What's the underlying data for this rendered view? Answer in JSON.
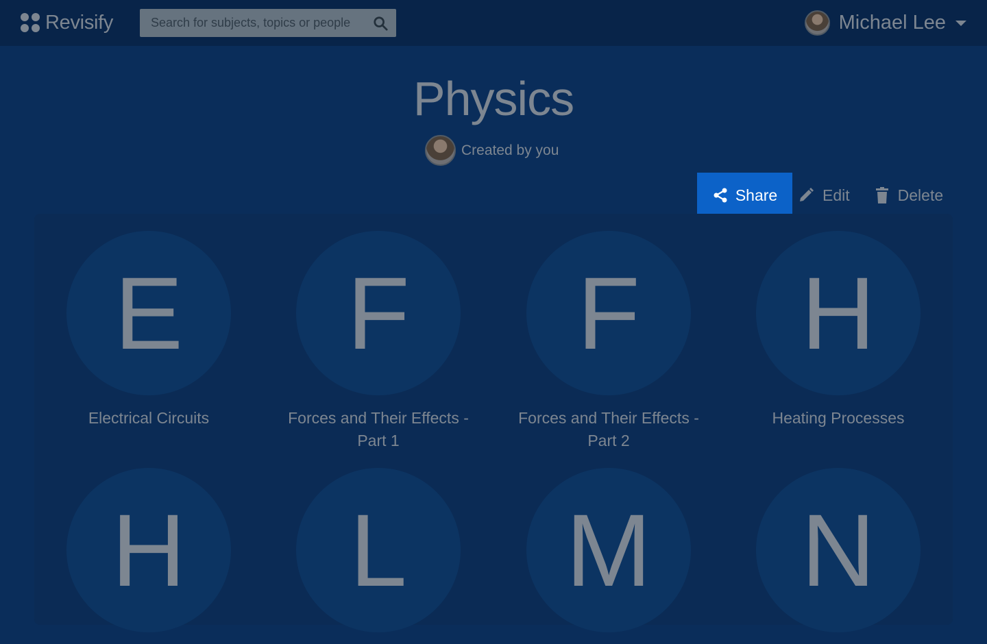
{
  "app": {
    "name": "Revisify"
  },
  "search": {
    "placeholder": "Search for subjects, topics or people"
  },
  "user": {
    "name": "Michael Lee"
  },
  "page": {
    "title": "Physics",
    "created_by": "Created by you"
  },
  "actions": {
    "share": "Share",
    "edit": "Edit",
    "delete": "Delete"
  },
  "colors": {
    "accent": "#0c62c8",
    "background": "#0a2d5a",
    "topbar": "#082449"
  },
  "topics": [
    {
      "letter": "E",
      "name": "Electrical Circuits"
    },
    {
      "letter": "F",
      "name": "Forces and Their Effects - Part 1"
    },
    {
      "letter": "F",
      "name": "Forces and Their Effects - Part 2"
    },
    {
      "letter": "H",
      "name": "Heating Processes"
    },
    {
      "letter": "H",
      "name": ""
    },
    {
      "letter": "L",
      "name": ""
    },
    {
      "letter": "M",
      "name": ""
    },
    {
      "letter": "N",
      "name": ""
    }
  ]
}
